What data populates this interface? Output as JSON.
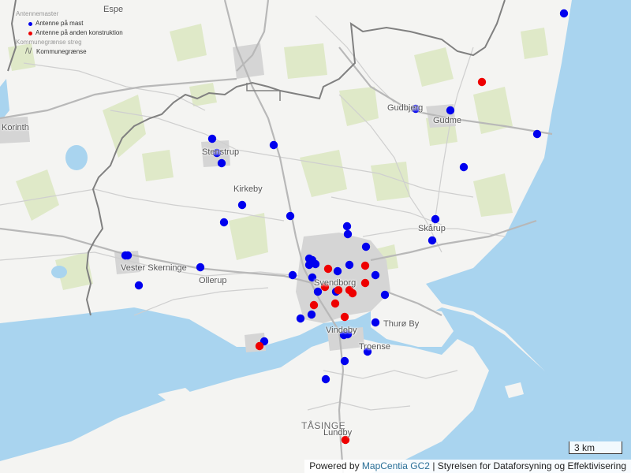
{
  "legend": {
    "layer_title": "Antennemaster",
    "items": [
      {
        "label": "Antenne på mast",
        "color": "#0000ee"
      },
      {
        "label": "Antenne på anden konstruktion",
        "color": "#ee0000"
      }
    ],
    "boundary_title": "Kommunegrænse streg",
    "boundary_item": "Kommunegrænse"
  },
  "places": {
    "espe": "Espe",
    "korinth": "Korinth",
    "gudbjerg": "Gudbjerg",
    "gudme": "Gudme",
    "stenstrup": "Stenstrup",
    "kirkeby": "Kirkeby",
    "skarup": "Skårup",
    "vester_skerninge": "Vester Skerninge",
    "ollerup": "Ollerup",
    "svendborg": "Svendborg",
    "thuro_by": "Thurø By",
    "vindeby": "Vindeby",
    "troense": "Troense",
    "tasinge": "TÅSINGE",
    "lundby": "Lundby"
  },
  "scale": {
    "label": "3 km"
  },
  "attribution": {
    "prefix": "Powered by",
    "link_text": "MapCentia GC2",
    "suffix": "| Styrelsen for Dataforsyning og Effektivisering"
  },
  "colors": {
    "water": "#a9d4ef",
    "land": "#f4f4f2",
    "field": "#dfe9c8",
    "mast": "#0000ee",
    "other": "#ee0000",
    "boundary": "#808080"
  }
}
